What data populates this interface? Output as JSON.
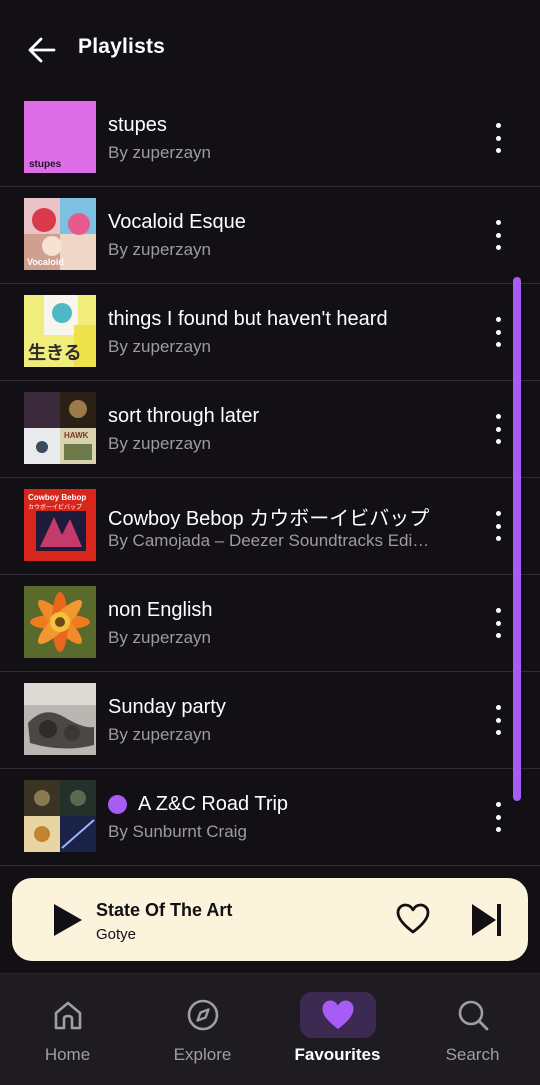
{
  "header": {
    "title": "Playlists",
    "back_icon": "arrow-left-icon"
  },
  "playlists": [
    {
      "title": "stupes",
      "subtitle": "By zuperzayn",
      "cover_text": "stupes",
      "badge": false
    },
    {
      "title": "Vocaloid Esque",
      "subtitle": "By zuperzayn",
      "cover_text": "Vocaloid",
      "badge": false
    },
    {
      "title": "things I found but haven't heard",
      "subtitle": "By zuperzayn",
      "cover_text": "生きる",
      "badge": false
    },
    {
      "title": "sort through later",
      "subtitle": "By zuperzayn",
      "cover_text": "HAWK",
      "badge": false
    },
    {
      "title": "Cowboy Bebop カウボーイビバップ",
      "subtitle": "By Camojada – Deezer Soundtracks Edi…",
      "cover_text": "Cowboy Bebop",
      "cover_text_2": "カウボーイビバップ",
      "badge": false
    },
    {
      "title": "non English",
      "subtitle": "By zuperzayn",
      "badge": false
    },
    {
      "title": "Sunday party",
      "subtitle": "By zuperzayn",
      "badge": false
    },
    {
      "title": "A Z&C Road Trip",
      "subtitle": "By Sunburnt Craig",
      "badge": true
    }
  ],
  "player": {
    "title": "State Of The Art",
    "artist": "Gotye"
  },
  "nav": {
    "items": [
      {
        "label": "Home",
        "icon": "home-icon",
        "active": false
      },
      {
        "label": "Explore",
        "icon": "compass-icon",
        "active": false
      },
      {
        "label": "Favourites",
        "icon": "heart-icon",
        "active": true
      },
      {
        "label": "Search",
        "icon": "search-icon",
        "active": false
      }
    ]
  },
  "colors": {
    "background": "#121014",
    "accent": "#a75cf5",
    "player_bg": "#fcf3dc",
    "subtitle": "#9d9aa3",
    "nav_bg": "#1e1c21"
  }
}
